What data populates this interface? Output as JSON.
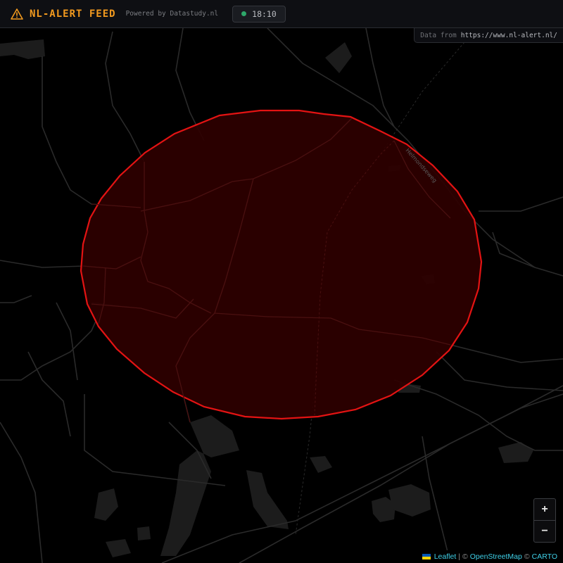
{
  "header": {
    "title": "NL-ALERT FEED",
    "powered_by": "Powered by Datastudy.nl",
    "time": "18:10",
    "warn_icon": "warning-triangle-icon",
    "accent": "#f29a1f",
    "live_color": "#2ea86a"
  },
  "source": {
    "label": "Data from",
    "url": "https://www.nl-alert.nl/"
  },
  "map": {
    "road_label": "Helmondseweg",
    "alert_fill": "#2e0000",
    "alert_stroke": "#e31313"
  },
  "zoom": {
    "in_label": "+",
    "out_label": "−"
  },
  "attribution": {
    "leaflet": "Leaflet",
    "sep1": "|",
    "copy1": "©",
    "osm": "OpenStreetMap",
    "copy2": "©",
    "carto": "CARTO"
  }
}
